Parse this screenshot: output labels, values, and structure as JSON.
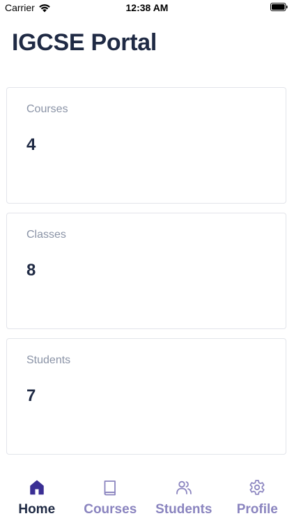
{
  "status_bar": {
    "carrier": "Carrier",
    "time": "12:38 AM"
  },
  "header": {
    "title": "IGCSE Portal"
  },
  "cards": [
    {
      "label": "Courses",
      "value": "4"
    },
    {
      "label": "Classes",
      "value": "8"
    },
    {
      "label": "Students",
      "value": "7"
    }
  ],
  "tab_bar": {
    "active": "Home",
    "tabs": [
      {
        "label": "Home",
        "icon": "home-icon"
      },
      {
        "label": "Courses",
        "icon": "book-icon"
      },
      {
        "label": "Students",
        "icon": "users-icon"
      },
      {
        "label": "Profile",
        "icon": "gear-icon"
      }
    ]
  },
  "colors": {
    "title": "#1f2a44",
    "label": "#8a93a6",
    "tab_active_icon": "#3a2f94",
    "tab_inactive": "#8a84bf",
    "card_border": "#e2e4ea"
  }
}
